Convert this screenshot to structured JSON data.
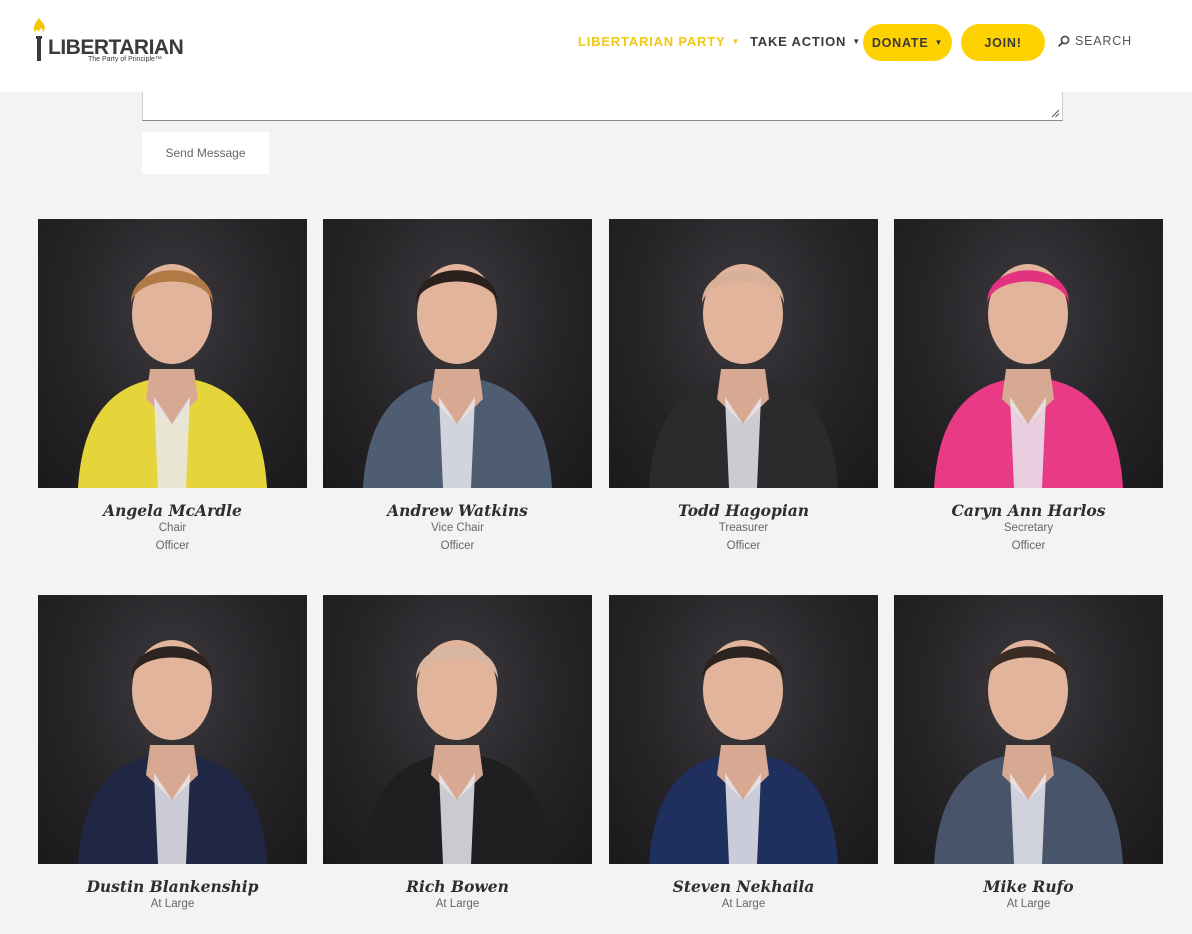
{
  "header": {
    "logo": {
      "wordmark": "LIBERTARIAN",
      "tagline": "The Party of Principle™"
    },
    "nav": {
      "party_label": "LIBERTARIAN PARTY",
      "action_label": "TAKE ACTION",
      "donate_label": "DONATE",
      "join_label": "JOIN!",
      "search_label": "SEARCH"
    }
  },
  "contact_form": {
    "send_label": "Send Message"
  },
  "members": [
    {
      "name": "Angela McArdle",
      "title": "Chair",
      "group": "Officer",
      "hair": "#b07a45",
      "outfit": "#e5d43a"
    },
    {
      "name": "Andrew Watkins",
      "title": "Vice Chair",
      "group": "Officer",
      "hair": "#2b211c",
      "outfit": "#4f5d73"
    },
    {
      "name": "Todd Hagopian",
      "title": "Treasurer",
      "group": "Officer",
      "hair": "#d9b098",
      "outfit": "#2b2b2e"
    },
    {
      "name": "Caryn Ann Harlos",
      "title": "Secretary",
      "group": "Officer",
      "hair": "#e3327f",
      "outfit": "#e83a85"
    },
    {
      "name": "Dustin Blankenship",
      "title": "At Large",
      "group": "",
      "hair": "#2c2420",
      "outfit": "#1f2744"
    },
    {
      "name": "Rich Bowen",
      "title": "At Large",
      "group": "",
      "hair": "#d8b5a2",
      "outfit": "#1f1f22"
    },
    {
      "name": "Steven Nekhaila",
      "title": "At Large",
      "group": "",
      "hair": "#2a2320",
      "outfit": "#1f2f5e"
    },
    {
      "name": "Mike Rufo",
      "title": "At Large",
      "group": "",
      "hair": "#3a2c24",
      "outfit": "#48546a"
    }
  ],
  "colors": {
    "accent": "#fed100",
    "accent_text": "#f2c811",
    "page_bg": "#f3f3f3"
  }
}
